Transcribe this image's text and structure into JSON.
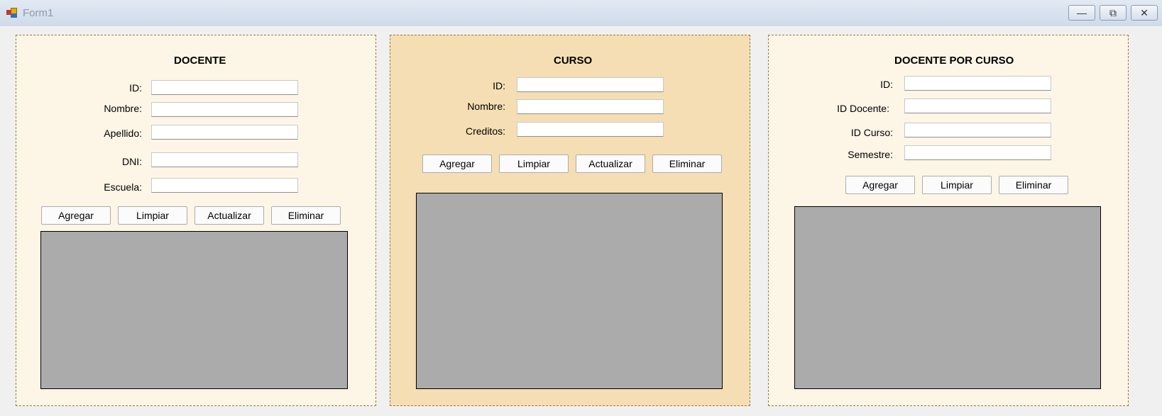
{
  "window": {
    "title": "Form1",
    "minimize": "—",
    "maximize": "⧉",
    "close": "✕"
  },
  "docente": {
    "heading": "DOCENTE",
    "labels": [
      "ID:",
      "Nombre:",
      "Apellido:",
      "DNI:",
      "Escuela:"
    ],
    "values": [
      "",
      "",
      "",
      "",
      ""
    ],
    "buttons": [
      "Agregar",
      "Limpiar",
      "Actualizar",
      "Eliminar"
    ]
  },
  "curso": {
    "heading": "CURSO",
    "labels": [
      "ID:",
      "Nombre:",
      "Creditos:"
    ],
    "values": [
      "",
      "",
      ""
    ],
    "buttons": [
      "Agregar",
      "Limpiar",
      "Actualizar",
      "Eliminar"
    ]
  },
  "docente_curso": {
    "heading": "DOCENTE POR CURSO",
    "labels": [
      "ID:",
      "ID Docente:",
      "ID Curso:",
      "Semestre:"
    ],
    "values": [
      "",
      "",
      "",
      ""
    ],
    "buttons": [
      "Agregar",
      "Limpiar",
      "Eliminar"
    ]
  },
  "colors": {
    "panel_light": "#fdf5e6",
    "panel_wheat": "#f5deb3",
    "grid_bg": "#ababab",
    "form_bg": "#f0f0f0"
  }
}
